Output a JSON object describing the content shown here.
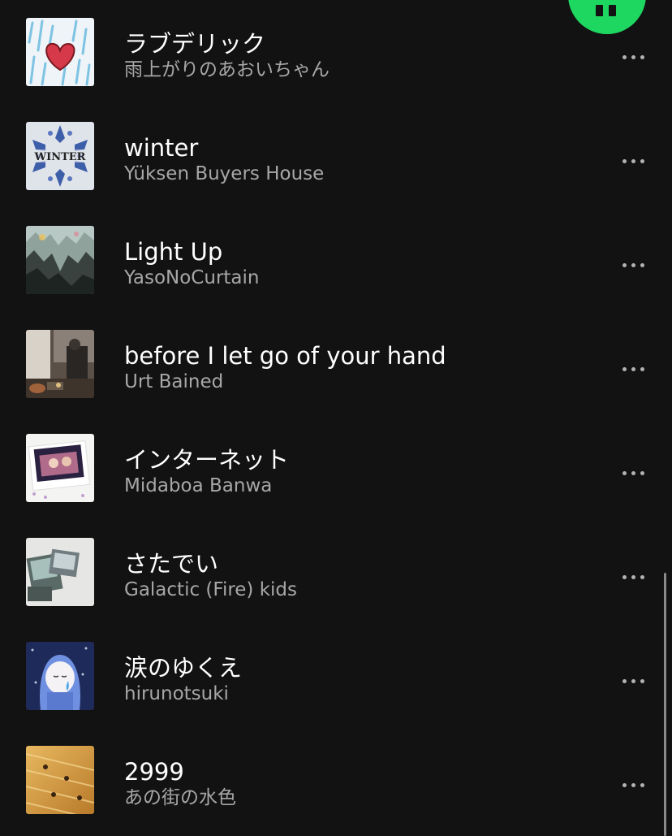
{
  "colors": {
    "background": "#121212",
    "accent": "#1ed760",
    "title": "#ffffff",
    "subtitle": "#a7a7a7"
  },
  "player": {
    "state_icon": "pause-icon"
  },
  "tracks": [
    {
      "title": "ラブデリック",
      "artist": "雨上がりのあおいちゃん",
      "cover_icon": "heart-rain-art"
    },
    {
      "title": "winter",
      "artist": "Yüksen Buyers House",
      "cover_icon": "snowflake-art",
      "cover_text": "WINTER"
    },
    {
      "title": "Light Up",
      "artist": "YasoNoCurtain",
      "cover_icon": "mountain-art"
    },
    {
      "title": "before I let go of your hand",
      "artist": "Urt Bained",
      "cover_icon": "room-photo-art"
    },
    {
      "title": "インターネット",
      "artist": "Midaboa Banwa",
      "cover_icon": "polaroid-art"
    },
    {
      "title": "さたでい",
      "artist": "Galactic (Fire) kids",
      "cover_icon": "photo-collage-art"
    },
    {
      "title": "涙のゆくえ",
      "artist": "hirunotsuki",
      "cover_icon": "crying-girl-art"
    },
    {
      "title": "2999",
      "artist": "あの街の水色",
      "cover_icon": "golden-texture-art"
    }
  ]
}
